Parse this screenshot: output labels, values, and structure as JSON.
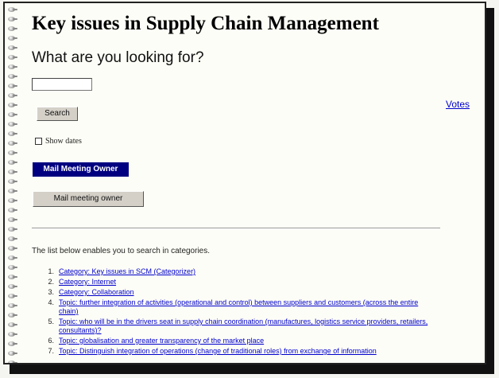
{
  "page": {
    "title": "Key issues in Supply Chain Management",
    "subtitle": "What are you looking for?"
  },
  "search": {
    "input_value": "",
    "button_label": "Search",
    "votes_link": "Votes",
    "show_dates_label": "Show dates",
    "show_dates_checked": false
  },
  "actions": {
    "mail_owner_bold": "Mail Meeting Owner",
    "mail_owner_button": "Mail meeting owner"
  },
  "intro_text": "The list below enables you to search in categories.",
  "categories": [
    {
      "num": "1.",
      "label": "Category: Key issues in SCM (Categorizer)"
    },
    {
      "num": "2.",
      "label": "Category: Internet"
    },
    {
      "num": "3.",
      "label": "Category: Collaboration"
    },
    {
      "num": "4.",
      "label": "Topic: further integration of activities (operational and control) between suppliers and customers (across the entire chain)"
    },
    {
      "num": "5.",
      "label": "Topic: who will be in the drivers seat in supply chain coordination (manufactures, logistics service providers, retailers, consultants)?"
    },
    {
      "num": "6.",
      "label": "Topic: globalisation and greater transparency of the market place"
    },
    {
      "num": "7.",
      "label": "Topic: Distinguish integration of operations (change of traditional roles) from exchange of information"
    }
  ],
  "colors": {
    "link": "#0000cc",
    "mail_button_bg": "#000080",
    "page_bg": "#fdfdf7"
  }
}
